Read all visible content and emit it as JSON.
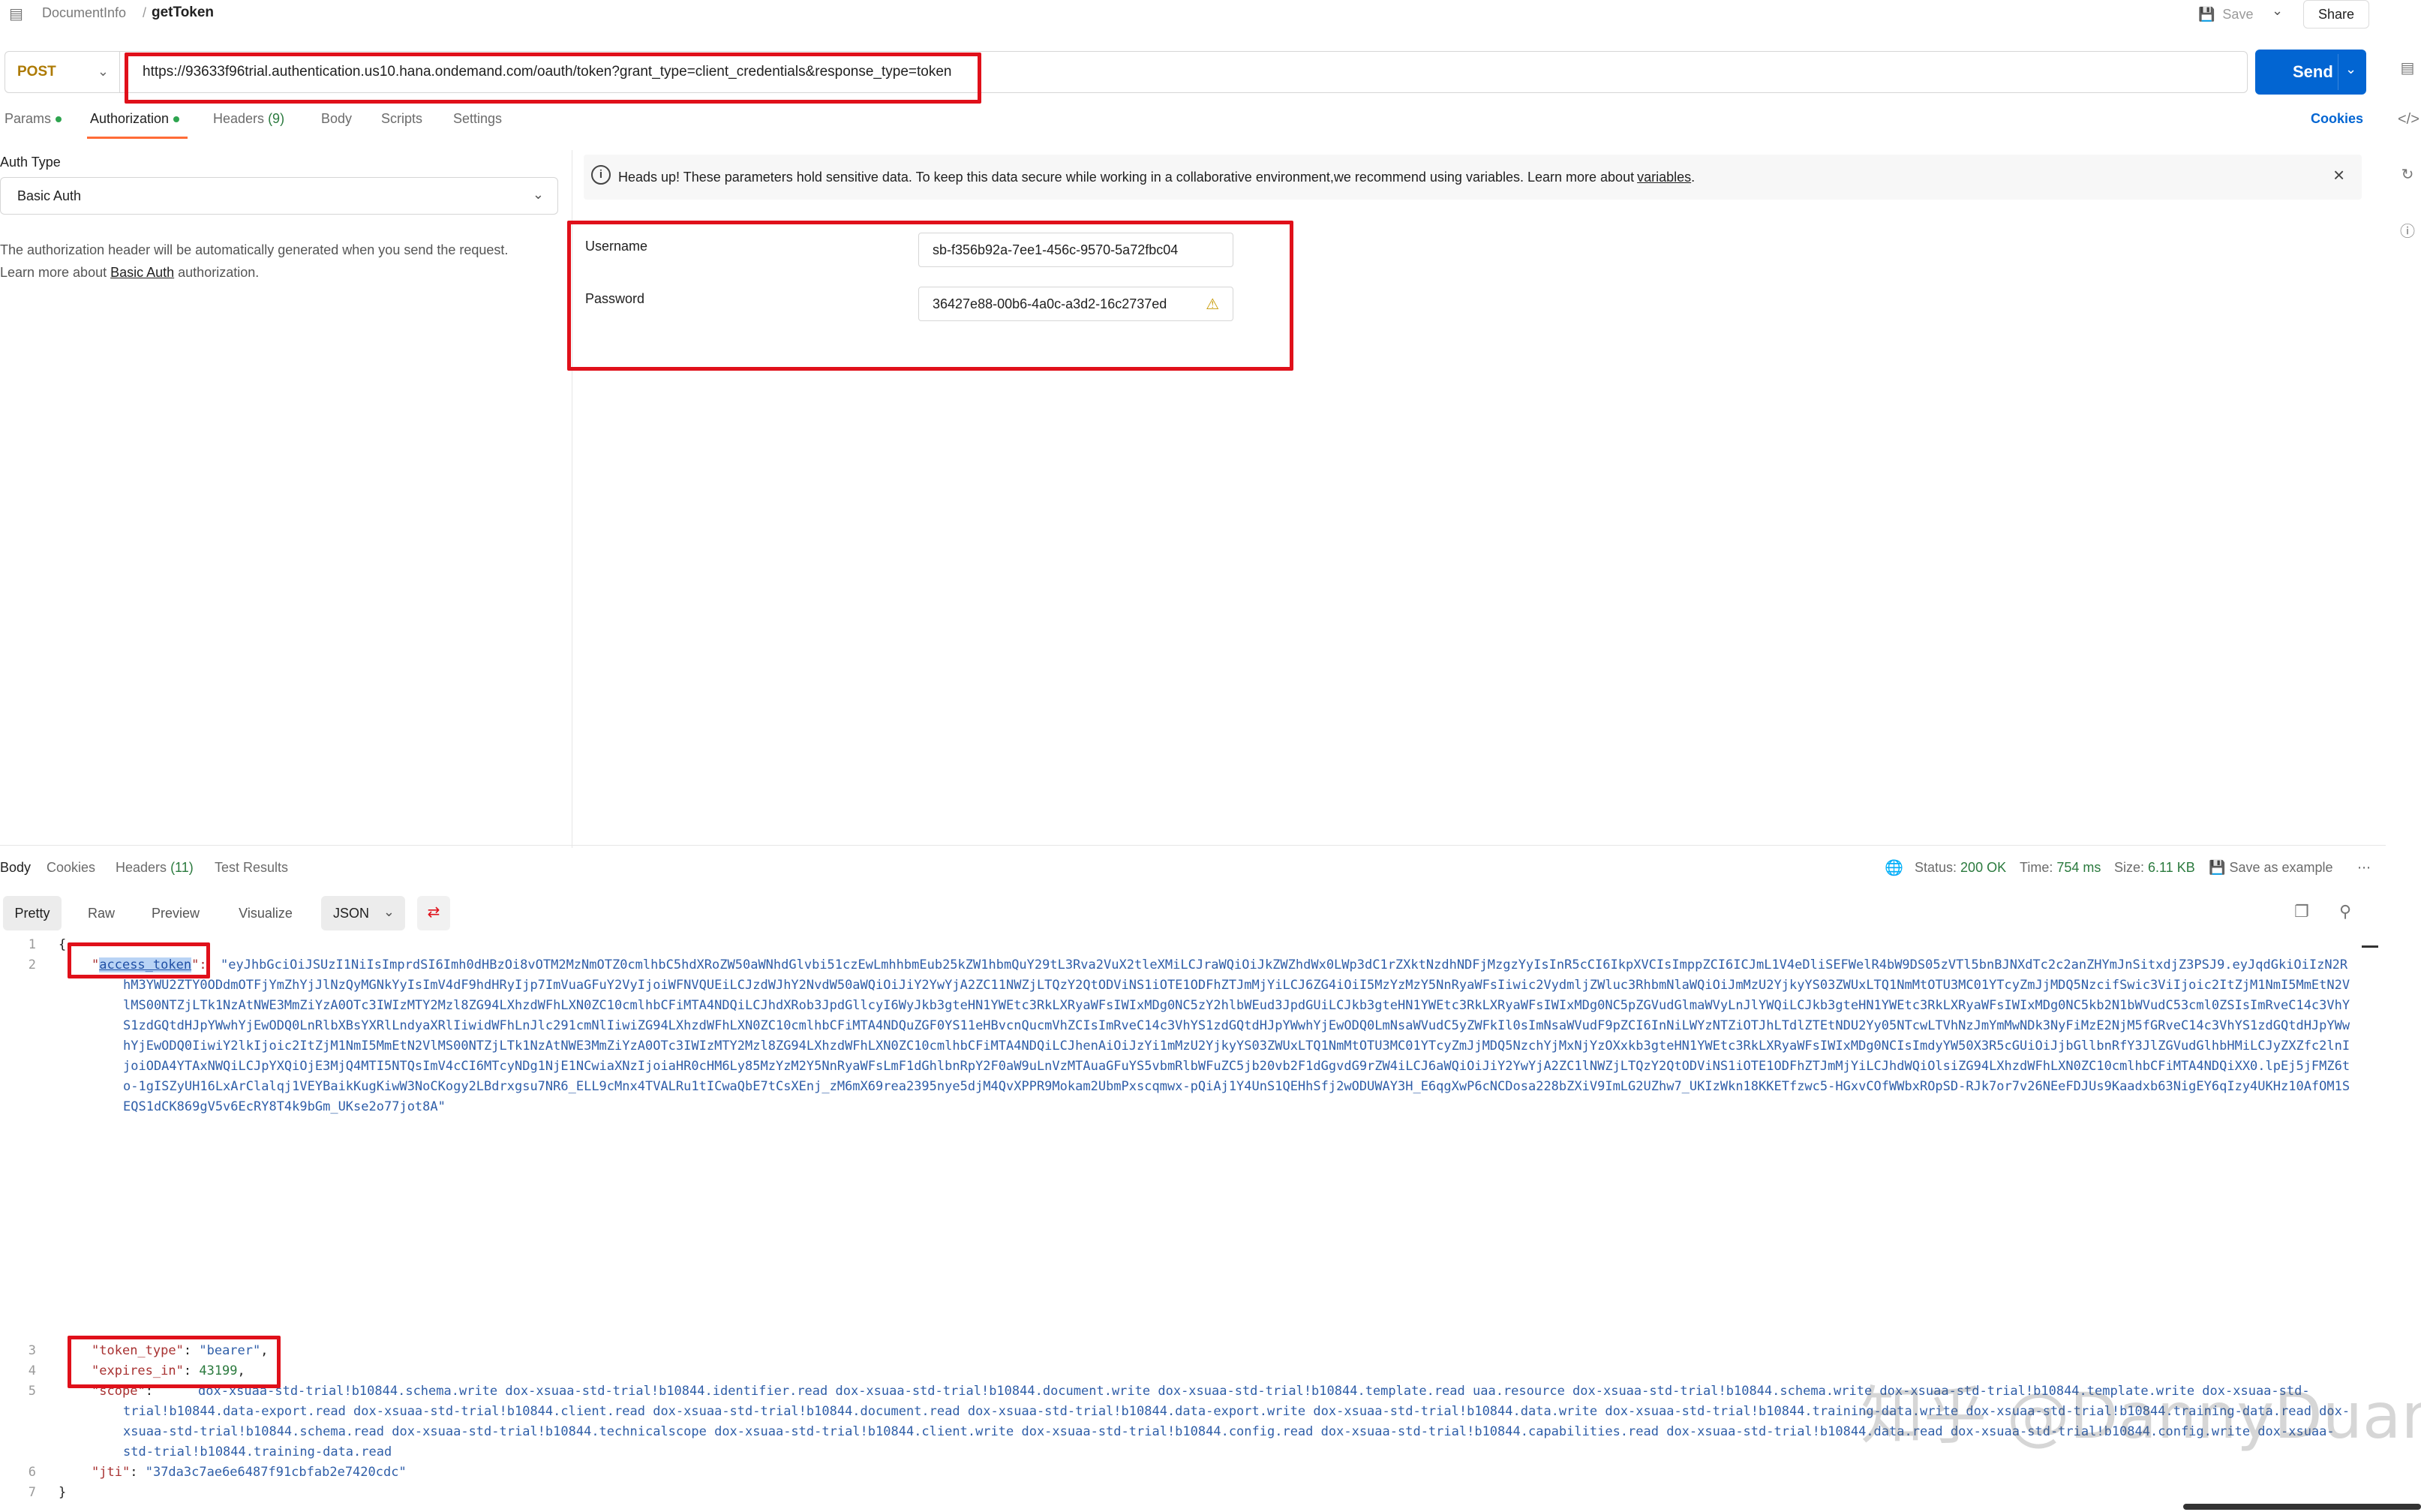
{
  "topbar": {
    "crumb_parent": "DocumentInfo",
    "crumb_sep": "/",
    "crumb_current": "getToken",
    "save_label": "Save",
    "share_label": "Share"
  },
  "request": {
    "method": "POST",
    "url": "https://93633f96trial.authentication.us10.hana.ondemand.com/oauth/token?grant_type=client_credentials&response_type=token",
    "send_label": "Send"
  },
  "tabs": [
    {
      "label": "Params"
    },
    {
      "label": "Authorization"
    },
    {
      "label": "Headers",
      "count": "(9)"
    },
    {
      "label": "Body"
    },
    {
      "label": "Scripts"
    },
    {
      "label": "Settings"
    }
  ],
  "cookies_label": "Cookies",
  "auth": {
    "type_label": "Auth Type",
    "type_value": "Basic Auth",
    "help_line1": "The authorization header will be automatically generated when you send the request.",
    "help_line2_pre": "Learn more about ",
    "help_link": "Basic Auth",
    "help_line2_post": " authorization."
  },
  "banner": {
    "text": "Heads up! These parameters hold sensitive data. To keep this data secure while working in a collaborative environment,we recommend using variables. Learn more about",
    "link": "variables",
    "end": "."
  },
  "credentials": {
    "username_label": "Username",
    "username_value": "sb-f356b92a-7ee1-456c-9570-5a72fbc04",
    "password_label": "Password",
    "password_value": "36427e88-00b6-4a0c-a3d2-16c2737ed"
  },
  "response": {
    "tabs": [
      {
        "label": "Body"
      },
      {
        "label": "Cookies"
      },
      {
        "label": "Headers",
        "count": "(11)"
      },
      {
        "label": "Test Results"
      }
    ],
    "status_label": "Status:",
    "status_value": "200 OK",
    "time_label": "Time:",
    "time_value": "754 ms",
    "size_label": "Size:",
    "size_value": "6.11 KB",
    "save_example": "Save as example",
    "views": [
      "Pretty",
      "Raw",
      "Preview",
      "Visualize"
    ],
    "format": "JSON"
  },
  "code": {
    "line_numbers": [
      "1",
      "2",
      "3",
      "4",
      "5",
      "6",
      "7"
    ],
    "open_brace": "{",
    "close_brace": "}",
    "k_access_token": "access_token",
    "access_token_value": "\"eyJhbGciOiJSUzI1NiIsImprdSI6Imh0dHBzOi8vOTM2MzNmOTZ0cmlhbC5hdXRoZW50aWNhdGlvbi51czEwLmhhbmEub25kZW1hbmQuY29tL3Rva2VuX2tleXMiLCJraWQiOiJkZWZhdWx0LWp3dC1rZXktNzdhNDFjMzgzYyIsInR5cCI6IkpXVCIsImppZCI6ICJmL1V4eDliSEFWelR4bW9DS05zVTl5bnBJNXdTc2c2anZHYmJnSitxdjZ3PSJ9.eyJqdGkiOiIzN2RhM3YWU2ZTY0ODdmOTFjYmZhYjJlNzQyMGNkYyIsImV4dF9hdHRyIjp7ImVuaGFuY2VyIjoiWFNVQUEiLCJzdWJhY2NvdW50aWQiOiJiY2YwYjA2ZC11NWZjLTQzY2QtODViNS1iOTE1ODFhZTJmMjYiLCJ6ZG4iOiI5MzYzMzY5NnRyaWFsIiwic2VydmljZWluc3RhbmNlaWQiOiJmMzU2YjkyYS03ZWUxLTQ1NmMtOTU3MC01YTcyZmJjMDQ5NzcifSwic3ViIjoic2ItZjM1NmI5MmEtN2VlMS00NTZjLTk1NzAtNWE3MmZiYzA0OTc3IWIzMTY2Mzl8ZG94LXhzdWFhLXN0ZC10cmlhbCFiMTA4NDQiLCJhdXRob3JpdGllcyI6WyJkb3gteHN1YWEtc3RkLXRyaWFsIWIxMDg0NC5zY2hlbWEud3JpdGUiLCJkb3gteHN1YWEtc3RkLXRyaWFsIWIxMDg0NC5pZGVudGlmaWVyLnJlYWQiLCJkb3gteHN1YWEtc3RkLXRyaWFsIWIxMDg0NC5kb2N1bWVudC53cml0ZSIsImRveC14c3VhYS1zdGQtdHJpYWwhYjEwODQ0LnRlbXBsYXRlLndyaXRlIiwidWFhLnJlc291cmNlIiwiZG94LXhzdWFhLXN0ZC10cmlhbCFiMTA4NDQuZGF0YS11eHBvcnQucmVhZCIsImRveC14c3VhYS1zdGQtdHJpYWwhYjEwODQ0LmNsaWVudC5yZWFkIl0sImNsaWVudF9pZCI6InNiLWYzNTZiOTJhLTdlZTEtNDU2Yy05NTcwLTVhNzJmYmMwNDk3NyFiMzE2NjM5fGRveC14c3VhYS1zdGQtdHJpYWwhYjEwODQ0IiwiY2lkIjoic2ItZjM1NmI5MmEtN2VlMS00NTZjLTk1NzAtNWE3MmZiYzA0OTc3IWIzMTY2Mzl8ZG94LXhzdWFhLXN0ZC10cmlhbCFiMTA4NDQiLCJhenAiOiJzYi1mMzU2YjkyYS03ZWUxLTQ1NmMtOTU3MC01YTcyZmJjMDQ5NzchYjMxNjYzOXxkb3gteHN1YWEtc3RkLXRyaWFsIWIxMDg0NCIsImdyYW50X3R5cGUiOiJjbGllbnRfY3JlZGVudGlhbHMiLCJyZXZfc2lnIjoiODA4YTAxNWQiLCJpYXQiOjE3MjQ4MTI5NTQsImV4cCI6MTcyNDg1NjE1NCwiaXNzIjoiaHR0cHM6Ly85MzYzM2Y5NnRyaWFsLmF1dGhlbnRpY2F0aW9uLnVzMTAuaGFuYS5vbmRlbWFuZC5jb20vb2F1dGgvdG9rZW4iLCJ6aWQiOiJiY2YwYjA2ZC1lNWZjLTQzY2QtODViNS1iOTE1ODFhZTJmMjYiLCJhdWQiOlsiZG94LXhzdWFhLXN0ZC10cmlhbCFiMTA4NDQiXX0.lpEj5jFMZ6to-1gISZyUH16LxArClalqj1VEYBaikKugKiwW3NoCKogy2LBdrxgsu7NR6_ELL9cMnx4TVALRu1tICwaQbE7tCsXEnj_zM6mX69rea2395nye5djM4QvXPPR9Mokam2UbmPxscqmwx-pQiAj1Y4UnS1QEHhSfj2wODUWAY3H_E6qgXwP6cNCDosa228bZXiV9ImLG2UZhw7_UKIzWkn18KKETfzwc5-HGxvCOfWWbxROpSD-RJk7or7v26NEeFDJUs9Kaadxb63NigEY6qIzy4UKHz10AfOM1SEQS1dCK869gV5v6EcRY8T4k9bGm_UKse2o77jot8A\"",
    "k_token_type": "token_type",
    "v_token_type": "bearer",
    "k_expires_in": "expires_in",
    "v_expires_in": "43199",
    "k_scope": "scope",
    "v_scope": "dox-xsuaa-std-trial!b10844.schema.write dox-xsuaa-std-trial!b10844.identifier.read dox-xsuaa-std-trial!b10844.document.write dox-xsuaa-std-trial!b10844.template.read uaa.resource dox-xsuaa-std-trial!b10844.schema.write dox-xsuaa-std-trial!b10844.template.write dox-xsuaa-std-trial!b10844.data-export.read dox-xsuaa-std-trial!b10844.client.read dox-xsuaa-std-trial!b10844.document.read dox-xsuaa-std-trial!b10844.data-export.write dox-xsuaa-std-trial!b10844.data.write dox-xsuaa-std-trial!b10844.training-data.write dox-xsuaa-std-trial!b10844.training-data.read dox-xsuaa-std-trial!b10844.schema.read dox-xsuaa-std-trial!b10844.technicalscope dox-xsuaa-std-trial!b10844.client.write dox-xsuaa-std-trial!b10844.config.read dox-xsuaa-std-trial!b10844.capabilities.read dox-xsuaa-std-trial!b10844.data.read dox-xsuaa-std-trial!b10844.config.write dox-xsuaa-std-trial!b10844.training-data.read",
    "k_jti": "jti",
    "v_jti": "37da3c7ae6e6487f91cbfab2e7420cdc"
  },
  "watermark": "知乎 @DannyDuan",
  "colors": {
    "accent": "#ff6c37",
    "send": "#0265d2",
    "highlight_box": "#e0101a",
    "ok": "#2b7a3e"
  }
}
